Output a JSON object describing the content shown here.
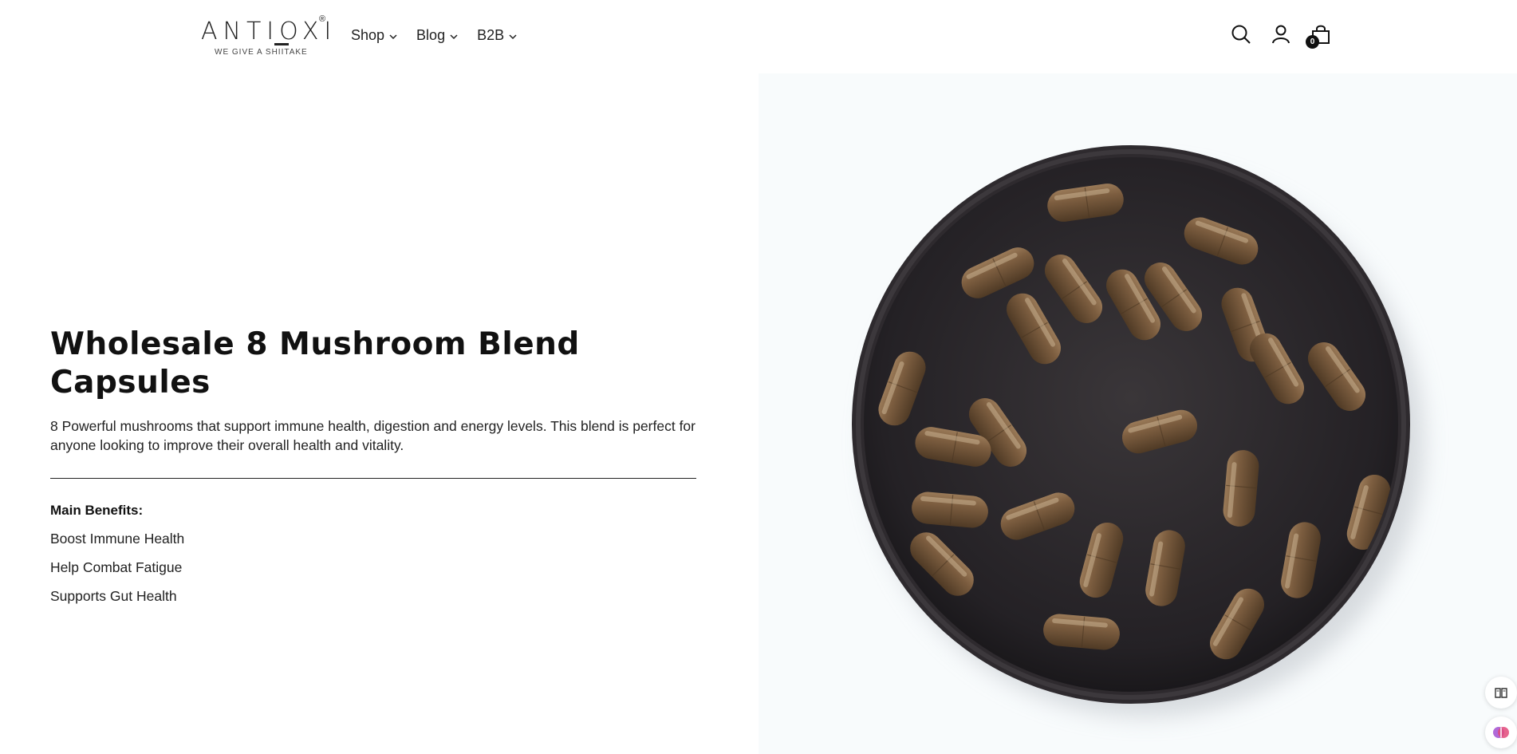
{
  "header": {
    "logo_text": "ANTIOXI",
    "logo_tagline": "WE GIVE A SHIITAKE",
    "nav": [
      {
        "label": "Shop"
      },
      {
        "label": "Blog"
      },
      {
        "label": "B2B"
      }
    ],
    "icons": [
      "search-icon",
      "account-icon",
      "cart-icon"
    ],
    "cart_count": "0"
  },
  "main": {
    "title": "Wholesale 8 Mushroom Blend Capsules",
    "description": "8 Powerful mushrooms that support immune health, digestion and energy levels. This blend is perfect for anyone looking to improve their overall health and vitality.",
    "benefits_heading": "Main Benefits:",
    "benefits": [
      "Boost Immune Health",
      "Help Combat Fatigue",
      "Supports Gut Health"
    ]
  },
  "colors": {
    "text": "#111111",
    "capsule": "#7a5a3a",
    "bowl": "#2a272b",
    "image_bg": "#f8fbfc"
  }
}
